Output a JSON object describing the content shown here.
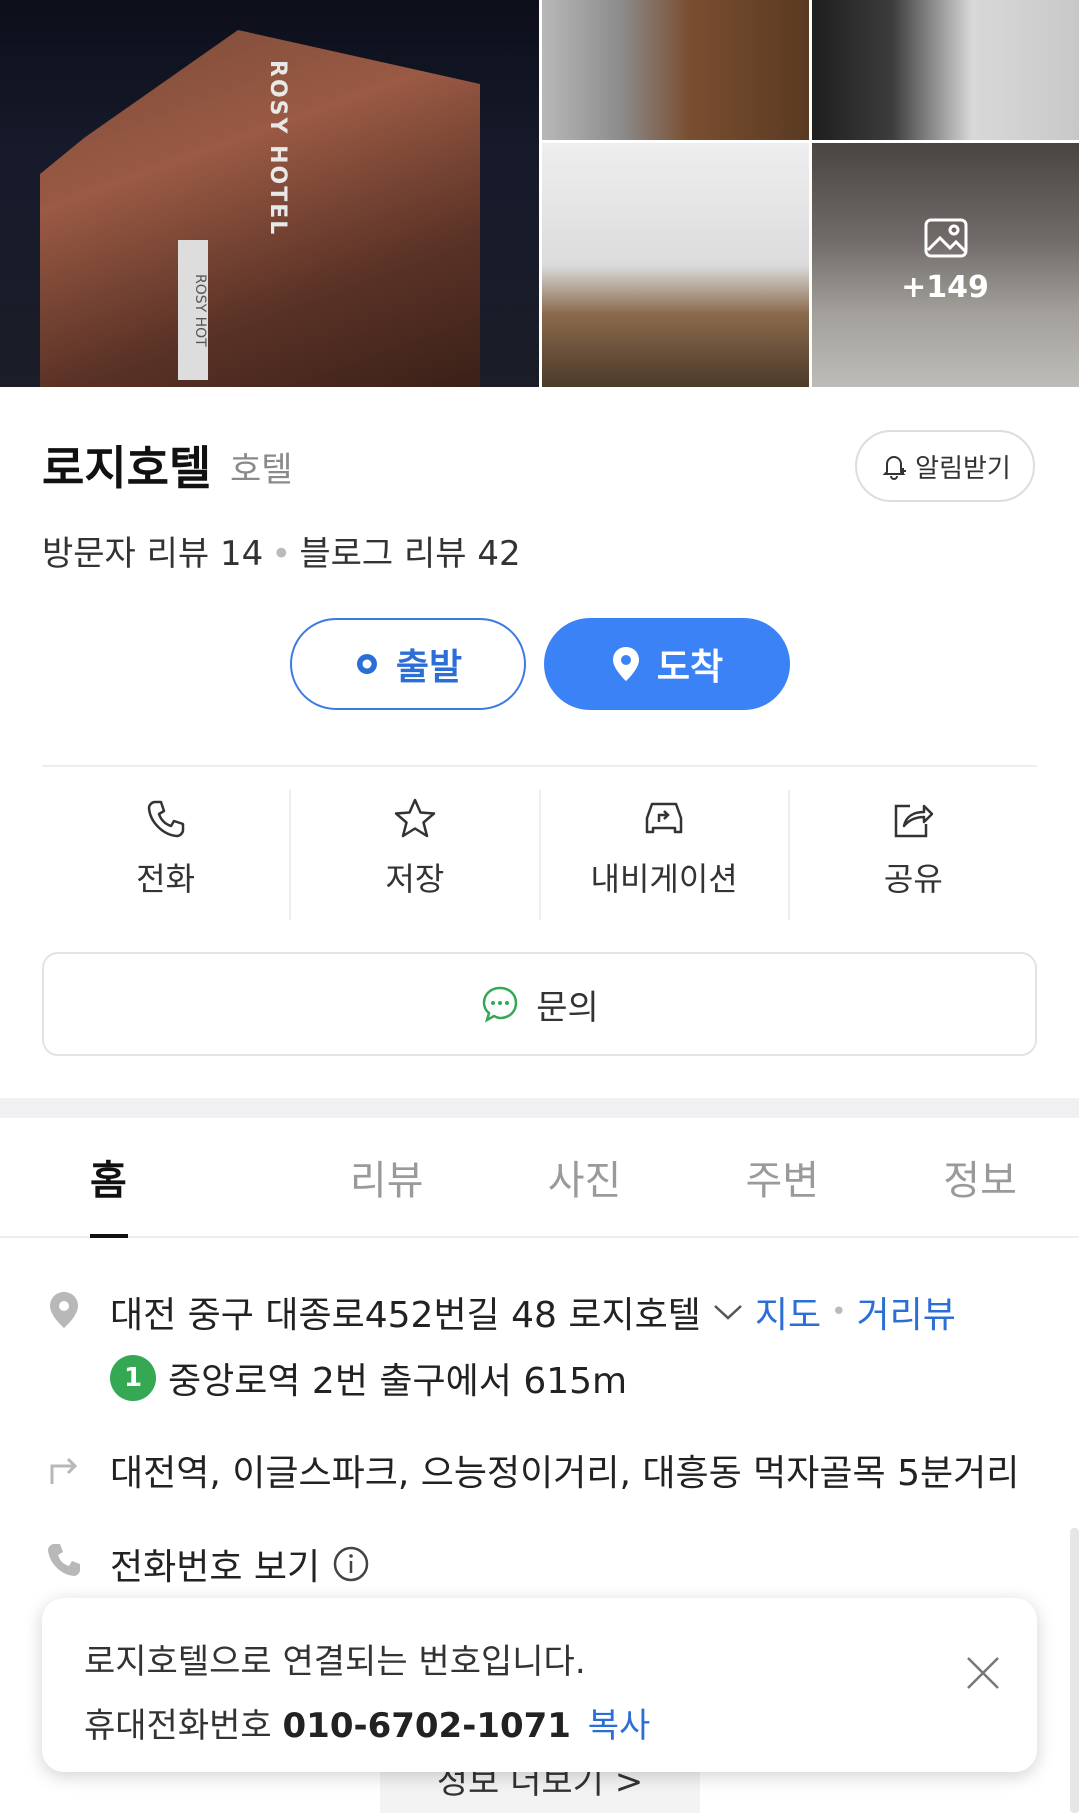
{
  "photos": {
    "main_sign": "ROSY HOTEL",
    "main_sign_small": "ROSY HOT",
    "more_count": "+149"
  },
  "place": {
    "name": "로지호텔",
    "category": "호텔",
    "alert_label": "알림받기",
    "visitor_reviews": "방문자 리뷰 14",
    "blog_reviews": "블로그 리뷰 42"
  },
  "route": {
    "depart_label": "출발",
    "arrive_label": "도착"
  },
  "actions": [
    {
      "label": "전화",
      "icon": "phone-icon"
    },
    {
      "label": "저장",
      "icon": "star-icon"
    },
    {
      "label": "내비게이션",
      "icon": "car-icon"
    },
    {
      "label": "공유",
      "icon": "share-icon"
    }
  ],
  "inquiry_label": "문의",
  "tabs": [
    {
      "label": "홈",
      "active": true
    },
    {
      "label": "리뷰",
      "active": false
    },
    {
      "label": "사진",
      "active": false
    },
    {
      "label": "주변",
      "active": false
    },
    {
      "label": "정보",
      "active": false
    }
  ],
  "info": {
    "address": "대전 중구 대종로452번길 48 로지호텔",
    "map_link": "지도",
    "street_view_link": "거리뷰",
    "subway_line": "1",
    "subway_text": "중앙로역 2번 출구에서 615m",
    "nearby": "대전역, 이글스파크, 으능정이거리, 대흥동 먹자골목 5분거리",
    "phone_label": "전화번호 보기"
  },
  "more_info_label": "정보 더보기 >",
  "toast": {
    "message": "로지호텔으로 연결되는 번호입니다.",
    "number_prefix": "휴대전화번호",
    "number": "010-6702-1071",
    "copy_label": "복사"
  },
  "colors": {
    "accent": "#3b82f6",
    "link": "#2b6fd6",
    "subway_line1": "#34a853"
  }
}
